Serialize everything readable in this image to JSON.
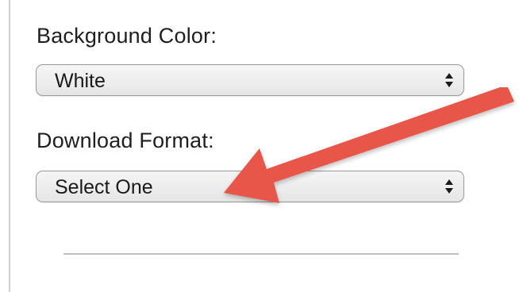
{
  "background_color": {
    "label": "Background Color:",
    "selected": "White"
  },
  "download_format": {
    "label": "Download Format:",
    "selected": "Select One"
  },
  "annotation": {
    "arrow_color": "#e8574a"
  }
}
